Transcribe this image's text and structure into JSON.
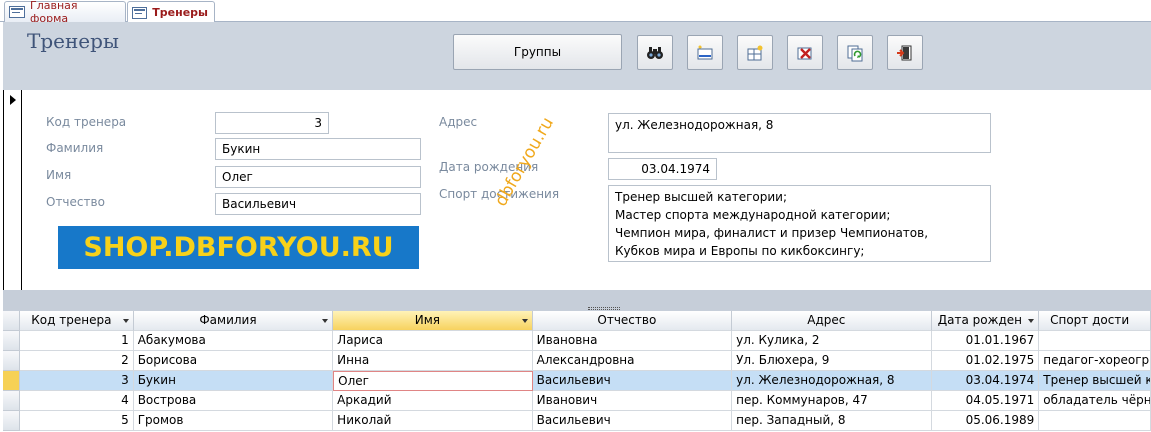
{
  "tabs": [
    {
      "label": "Главная форма",
      "active": false
    },
    {
      "label": "Тренеры",
      "active": true
    }
  ],
  "header": {
    "title": "Тренеры",
    "groups_button": "Группы",
    "icon_buttons": [
      "find-icon",
      "new-record-icon",
      "add-record-icon",
      "delete-record-icon",
      "refresh-icon",
      "close-form-icon"
    ]
  },
  "detail": {
    "labels": {
      "code": "Код тренера",
      "surname": "Фамилия",
      "name": "Имя",
      "patronymic": "Отчество",
      "address": "Адрес",
      "birth": "Дата рождения",
      "achievements": "Спорт достижения"
    },
    "values": {
      "code": "3",
      "surname": "Букин",
      "name": "Олег",
      "patronymic": "Васильевич",
      "address": "ул. Железнодорожная, 8",
      "birth": "03.04.1974",
      "achievements": [
        "Тренер высшей категории;",
        "Мастер спорта международной категории;",
        "Чемпион мира, финалист и призер Чемпионатов,",
        "Кубков мира и Европы по кикбоксингу;"
      ]
    },
    "logo_text": "SHOP.DBFORYOU.RU",
    "watermark": "dbforyou.ru"
  },
  "table": {
    "columns": [
      "Код тренера",
      "Фамилия",
      "Имя",
      "Отчество",
      "Адрес",
      "Дата рожден",
      "Спорт дости"
    ],
    "rows": [
      [
        "1",
        "Абакумова",
        "Лариса",
        "Ивановна",
        "ул. Кулика, 2",
        "01.01.1967",
        ""
      ],
      [
        "2",
        "Борисова",
        "Инна",
        "Александровна",
        "Ул. Блюхера, 9",
        "01.02.1975",
        "педагог-хореогр"
      ],
      [
        "3",
        "Букин",
        "Олег",
        "Васильевич",
        "ул. Железнодорожная, 8",
        "03.04.1974",
        "Тренер высшей к"
      ],
      [
        "4",
        "Вострова",
        "Аркадий",
        "Иванович",
        "пер. Коммунаров, 47",
        "04.05.1971",
        "обладатель чёрн"
      ],
      [
        "5",
        "Громов",
        "Николай",
        "Васильевич",
        "пер. Западный, 8",
        "05.06.1989",
        ""
      ]
    ],
    "current_row": 2
  },
  "colors": {
    "header_bg": "#cdd5df",
    "title_color": "#3f5479",
    "label_color": "#7a8a9e",
    "logo_bg": "#1778c9",
    "logo_text": "#f7d11a",
    "watermark": "#f0a81b",
    "current_row": "#c5def5",
    "selected_header": "#f7d25f"
  }
}
